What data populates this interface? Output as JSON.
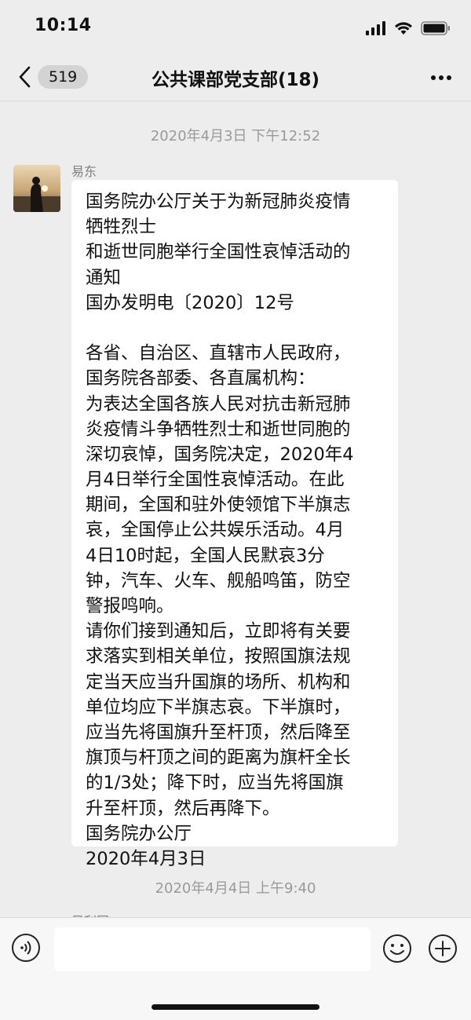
{
  "status_bar": {
    "time": "10:14"
  },
  "nav": {
    "back_count": "519",
    "title": "公共课部党支部(18)"
  },
  "chat": {
    "timestamp_1": "2020年4月3日 下午12:52",
    "message": {
      "sender": "易东",
      "lines": [
        "国务院办公厅关于为新冠肺炎疫情",
        "牺牲烈士",
        "和逝世同胞举行全国性哀悼活动的",
        "通知",
        "国办发明电〔2020〕12号",
        "",
        "各省、自治区、直辖市人民政府，",
        "国务院各部委、各直属机构：",
        "为表达全国各族人民对抗击新冠肺",
        "炎疫情斗争牺牲烈士和逝世同胞的",
        "深切哀悼，国务院决定，2020年4",
        "月4日举行全国性哀悼活动。在此",
        "期间，全国和驻外使领馆下半旗志",
        "哀，全国停止公共娱乐活动。4月",
        "4日10时起，全国人民默哀3分",
        "钟，汽车、火车、舰船鸣笛，防空",
        "警报鸣响。",
        "请你们接到通知后，立即将有关要",
        "求落实到相关单位，按照国旗法规",
        "定当天应当升国旗的场所、机构和",
        "单位均应下半旗志哀。下半旗时，",
        "应当先将国旗升至杆顶，然后降至",
        "旗顶与杆顶之间的距离为旗杆全长",
        "的1/3处；降下时，应当先将国旗",
        "升至杆顶，然后再降下。",
        "国务院办公厅",
        "2020年4月3日"
      ]
    },
    "timestamp_2": "2020年4月4日 上午9:40",
    "next_sender_partial": "吴利国"
  },
  "input_bar": {
    "value": "",
    "placeholder": ""
  },
  "icons": {
    "back": "chevron-left-icon",
    "more": "more-dots-icon",
    "voice": "voice-icon",
    "emoji": "emoji-icon",
    "plus": "plus-icon"
  }
}
